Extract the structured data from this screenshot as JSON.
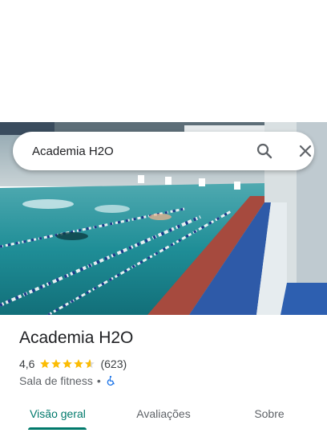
{
  "search": {
    "query": "Academia H2O"
  },
  "place": {
    "name": "Academia H2O",
    "rating": "4,6",
    "stars": 4.6,
    "review_count": "(623)",
    "category": "Sala de fitness",
    "separator": "•",
    "accessibility_icon": "wheelchair-icon"
  },
  "tabs": [
    {
      "label": "Visão geral",
      "active": true
    },
    {
      "label": "Avaliações",
      "active": false
    },
    {
      "label": "Sobre",
      "active": false
    }
  ],
  "colors": {
    "accent": "#00796b",
    "star": "#fbbc04",
    "accessibility": "#1a73e8"
  }
}
